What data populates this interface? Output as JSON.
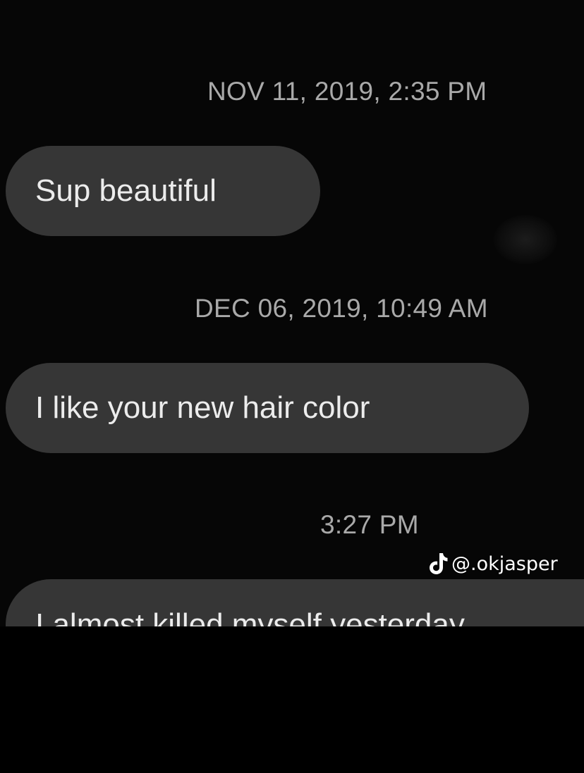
{
  "messages": [
    {
      "timestamp": "NOV 11, 2019, 2:35 PM",
      "text": "Sup beautiful"
    },
    {
      "timestamp": "DEC 06, 2019, 10:49 AM",
      "text": "I like your new hair color"
    },
    {
      "timestamp": "3:27 PM",
      "text": "I almost killed myself yesterday"
    }
  ],
  "watermark": {
    "icon": "tiktok-logo-icon",
    "handle": "@.okjasper"
  },
  "colors": {
    "background": "#060606",
    "bubble": "#363636",
    "bubble_text": "#ececec",
    "timestamp_text": "#a9a9a9"
  }
}
